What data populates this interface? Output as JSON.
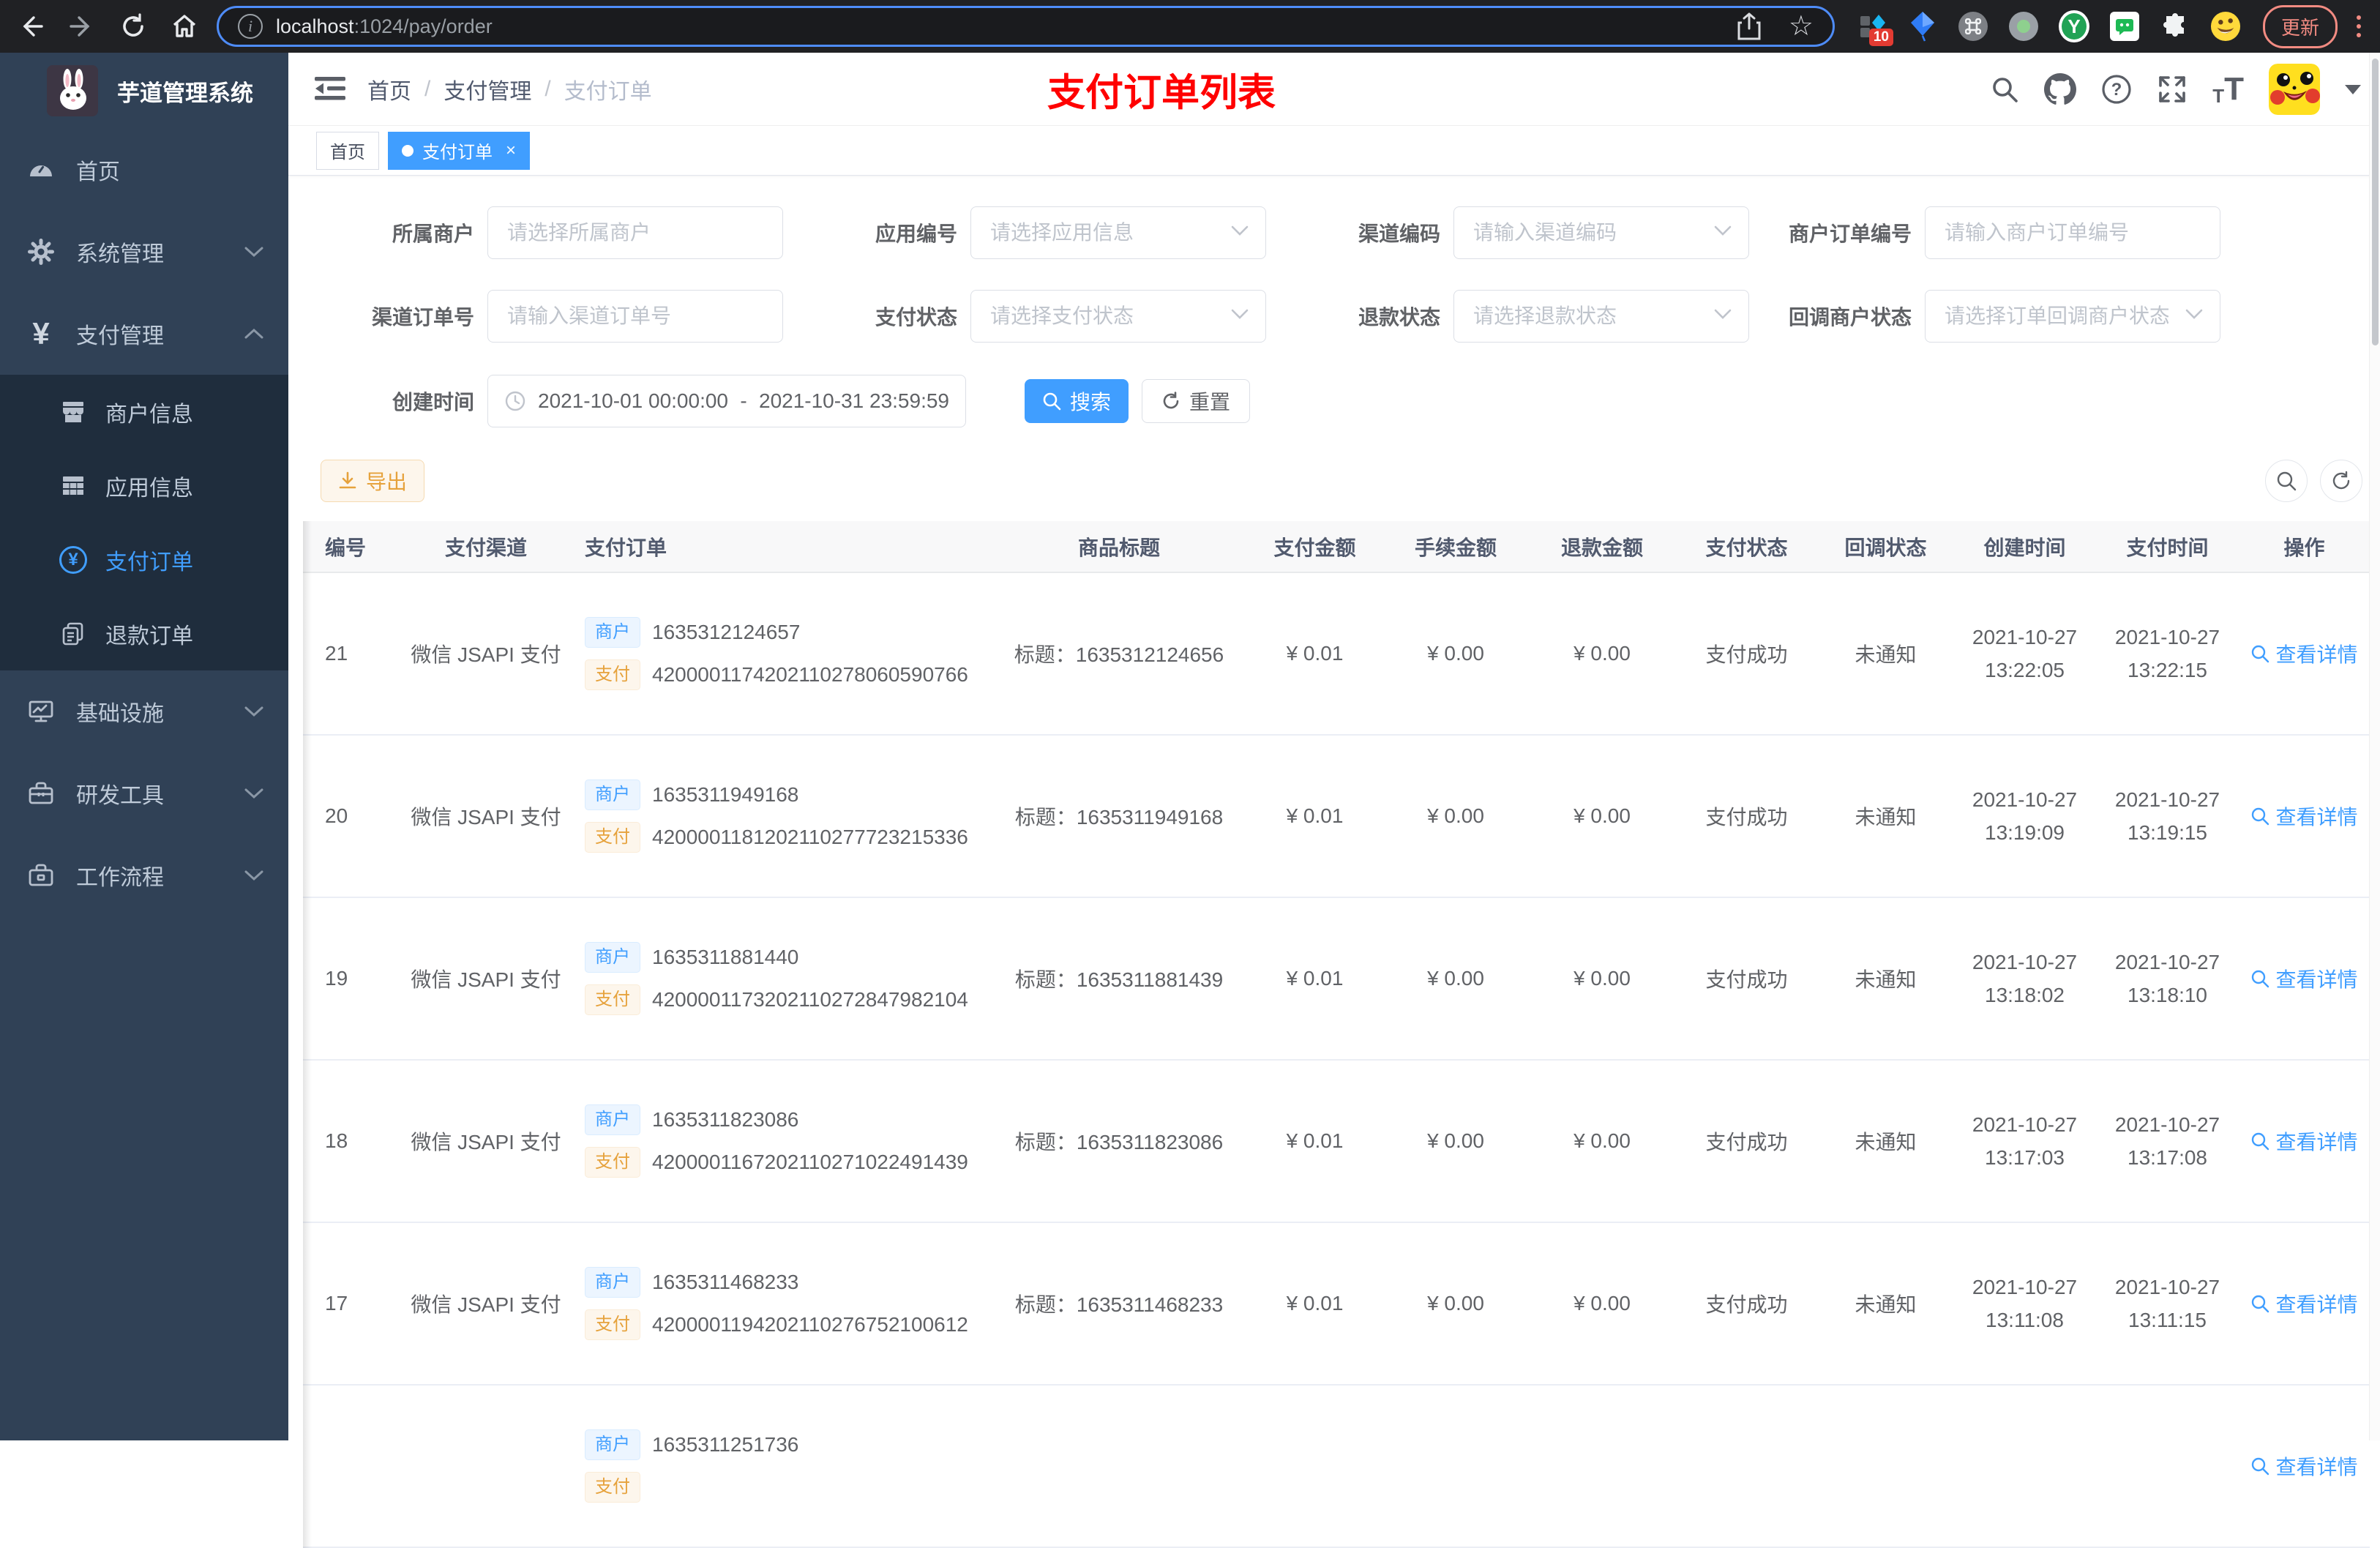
{
  "browser": {
    "url_host": "localhost",
    "url_rest": ":1024/pay/order",
    "update_label": "更新",
    "extension_badge": "10",
    "ext_y_label": "Y"
  },
  "sidebar": {
    "logo_title": "芋道管理系统",
    "items": [
      {
        "label": "首页"
      },
      {
        "label": "系统管理"
      },
      {
        "label": "支付管理"
      },
      {
        "label": "基础设施"
      },
      {
        "label": "研发工具"
      },
      {
        "label": "工作流程"
      }
    ],
    "submenu": [
      {
        "label": "商户信息"
      },
      {
        "label": "应用信息"
      },
      {
        "label": "支付订单"
      },
      {
        "label": "退款订单"
      }
    ]
  },
  "header": {
    "breadcrumb": [
      "首页",
      "支付管理",
      "支付订单"
    ],
    "page_title": "支付订单列表"
  },
  "tags": {
    "home": "首页",
    "active": "支付订单",
    "close": "×"
  },
  "filters": {
    "merchant": {
      "label": "所属商户",
      "placeholder": "请选择所属商户"
    },
    "app": {
      "label": "应用编号",
      "placeholder": "请选择应用信息"
    },
    "channel_code": {
      "label": "渠道编码",
      "placeholder": "请输入渠道编码"
    },
    "merchant_order_no": {
      "label": "商户订单编号",
      "placeholder": "请输入商户订单编号"
    },
    "channel_order_no": {
      "label": "渠道订单号",
      "placeholder": "请输入渠道订单号"
    },
    "pay_status": {
      "label": "支付状态",
      "placeholder": "请选择支付状态"
    },
    "refund_status": {
      "label": "退款状态",
      "placeholder": "请选择退款状态"
    },
    "notify_status": {
      "label": "回调商户状态",
      "placeholder": "请选择订单回调商户状态"
    },
    "create_time": {
      "label": "创建时间",
      "start": "2021-10-01 00:00:00",
      "separator": "-",
      "end": "2021-10-31 23:59:59"
    },
    "search_label": "搜索",
    "reset_label": "重置"
  },
  "toolbar": {
    "export_label": "导出"
  },
  "table": {
    "headers": [
      "编号",
      "支付渠道",
      "支付订单",
      "商品标题",
      "支付金额",
      "手续金额",
      "退款金额",
      "支付状态",
      "回调状态",
      "创建时间",
      "支付时间",
      "操作"
    ],
    "merchant_tag": "商户",
    "pay_tag": "支付",
    "action_label": "查看详情",
    "rows": [
      {
        "id": "21",
        "channel": "微信 JSAPI 支付",
        "merchant_no": "1635312124657",
        "channel_no": "4200001174202110278060590766",
        "title": "标题：1635312124656",
        "amount": "¥ 0.01",
        "fee": "¥ 0.00",
        "refund": "¥ 0.00",
        "status": "支付成功",
        "notify": "未通知",
        "created_date": "2021-10-27",
        "created_time": "13:22:05",
        "paid_date": "2021-10-27",
        "paid_time": "13:22:15"
      },
      {
        "id": "20",
        "channel": "微信 JSAPI 支付",
        "merchant_no": "1635311949168",
        "channel_no": "4200001181202110277723215336",
        "title": "标题：1635311949168",
        "amount": "¥ 0.01",
        "fee": "¥ 0.00",
        "refund": "¥ 0.00",
        "status": "支付成功",
        "notify": "未通知",
        "created_date": "2021-10-27",
        "created_time": "13:19:09",
        "paid_date": "2021-10-27",
        "paid_time": "13:19:15"
      },
      {
        "id": "19",
        "channel": "微信 JSAPI 支付",
        "merchant_no": "1635311881440",
        "channel_no": "4200001173202110272847982104",
        "title": "标题：1635311881439",
        "amount": "¥ 0.01",
        "fee": "¥ 0.00",
        "refund": "¥ 0.00",
        "status": "支付成功",
        "notify": "未通知",
        "created_date": "2021-10-27",
        "created_time": "13:18:02",
        "paid_date": "2021-10-27",
        "paid_time": "13:18:10"
      },
      {
        "id": "18",
        "channel": "微信 JSAPI 支付",
        "merchant_no": "1635311823086",
        "channel_no": "4200001167202110271022491439",
        "title": "标题：1635311823086",
        "amount": "¥ 0.01",
        "fee": "¥ 0.00",
        "refund": "¥ 0.00",
        "status": "支付成功",
        "notify": "未通知",
        "created_date": "2021-10-27",
        "created_time": "13:17:03",
        "paid_date": "2021-10-27",
        "paid_time": "13:17:08"
      },
      {
        "id": "17",
        "channel": "微信 JSAPI 支付",
        "merchant_no": "1635311468233",
        "channel_no": "4200001194202110276752100612",
        "title": "标题：1635311468233",
        "amount": "¥ 0.01",
        "fee": "¥ 0.00",
        "refund": "¥ 0.00",
        "status": "支付成功",
        "notify": "未通知",
        "created_date": "2021-10-27",
        "created_time": "13:11:08",
        "paid_date": "2021-10-27",
        "paid_time": "13:11:15"
      },
      {
        "id": "",
        "channel": "",
        "merchant_no": "1635311251736",
        "channel_no": "",
        "title": "",
        "amount": "",
        "fee": "",
        "refund": "",
        "status": "",
        "notify": "",
        "created_date": "",
        "created_time": "",
        "paid_date": "",
        "paid_time": ""
      }
    ]
  }
}
